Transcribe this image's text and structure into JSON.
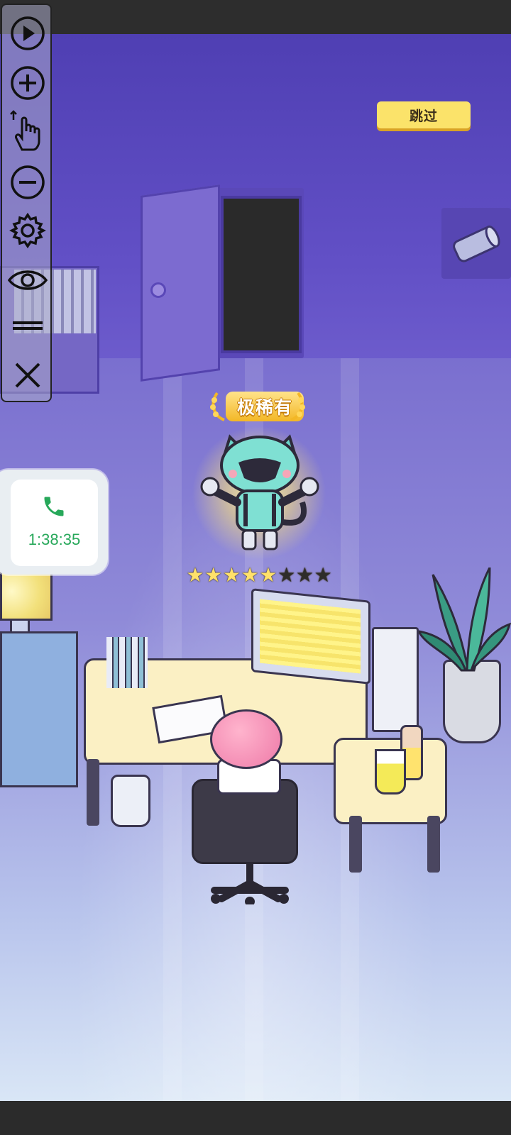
{
  "skip_button": {
    "label": "跳过"
  },
  "reward": {
    "rarity": "极稀有",
    "stars_filled": 5,
    "stars_total": 8
  },
  "call_widget": {
    "time": "1:38:35",
    "icon": "phone-icon"
  },
  "toolbar": {
    "items": [
      {
        "name": "play-icon"
      },
      {
        "name": "zoom-in-icon"
      },
      {
        "name": "tap-gesture-icon"
      },
      {
        "name": "zoom-out-icon"
      },
      {
        "name": "gear-icon"
      },
      {
        "name": "eye-icon"
      },
      {
        "name": "drag-handle-icon"
      },
      {
        "name": "close-icon"
      }
    ]
  },
  "colors": {
    "wall": "#5a48bd",
    "skip_button": "#fbe36a",
    "call_green": "#27a85a",
    "rarity_gold": "#f3b726",
    "star_filled": "#ffe16a",
    "star_empty": "#2e2c2a"
  }
}
